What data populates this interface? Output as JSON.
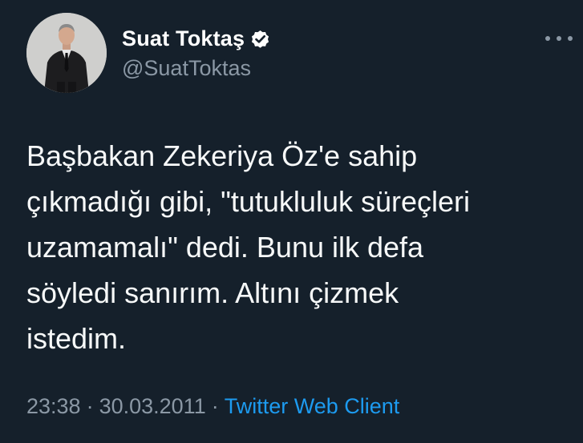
{
  "author": {
    "display_name": "Suat Toktaş",
    "handle": "@SuatToktas",
    "verified": true,
    "avatar_icon": "profile-photo"
  },
  "tweet": {
    "text": "Başbakan Zekeriya Öz'e sahip\nçıkmadığı gibi, \"tutukluluk süreçleri\nuzamamalı\" dedi. Bunu ilk defa\nsöyledi sanırım. Altını çizmek\nistedim."
  },
  "meta": {
    "time": "23:38",
    "separator": "·",
    "date": "30.03.2011",
    "client": "Twitter Web Client"
  },
  "colors": {
    "background": "#15202b",
    "text": "#f7f9f9",
    "muted": "#8b98a5",
    "accent": "#1d9bf0"
  },
  "icons": {
    "verified": "verified-badge-icon",
    "more": "more-options-icon"
  }
}
